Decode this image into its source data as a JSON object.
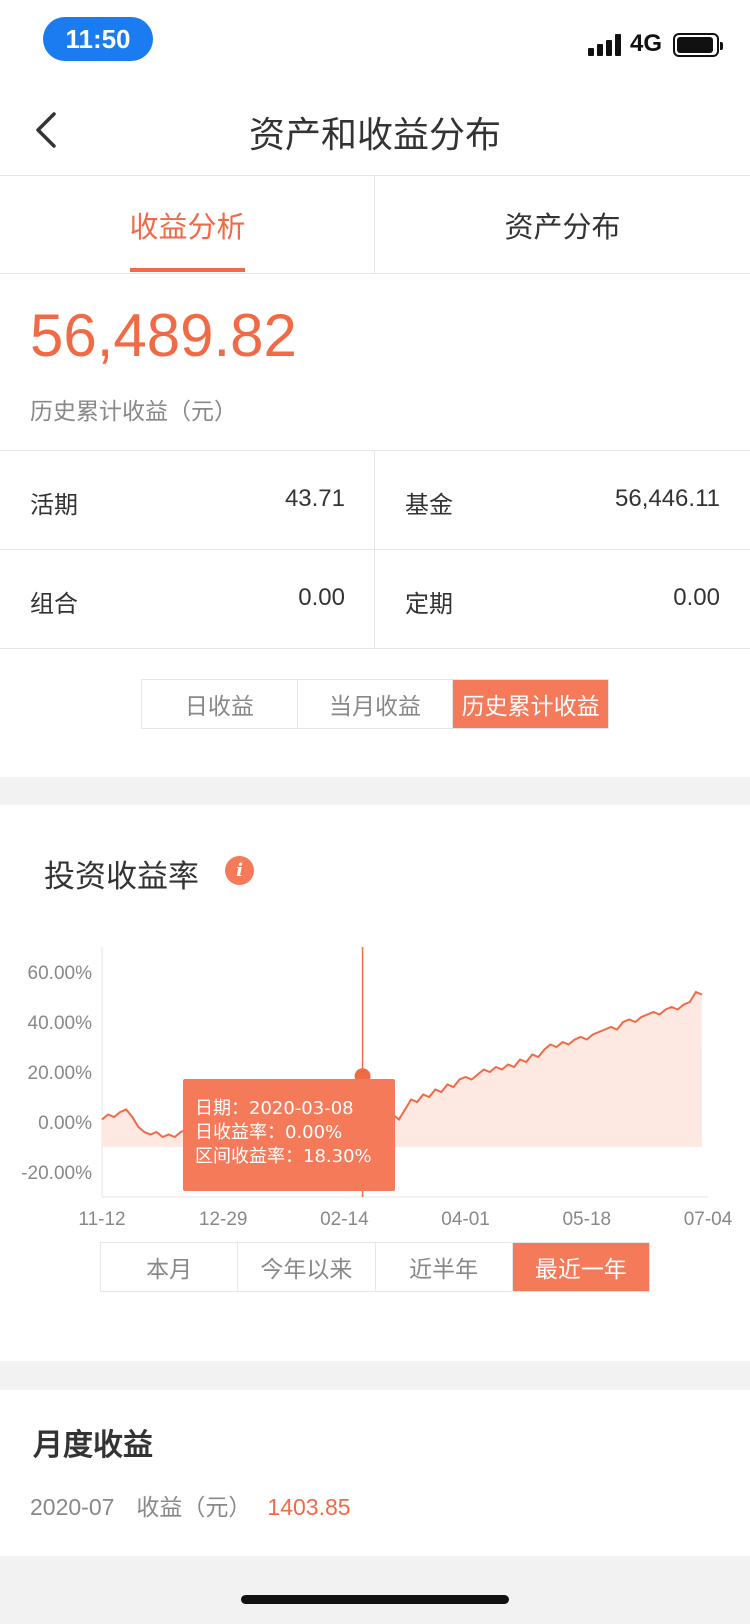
{
  "status_bar": {
    "time": "11:50",
    "network": "4G"
  },
  "nav": {
    "title": "资产和收益分布"
  },
  "tabs": [
    {
      "label": "收益分析",
      "active": true
    },
    {
      "label": "资产分布",
      "active": false
    }
  ],
  "summary": {
    "total": "56,489.82",
    "total_label": "历史累计收益（元）"
  },
  "breakdown": [
    {
      "label": "活期",
      "value": "43.71"
    },
    {
      "label": "基金",
      "value": "56,446.11"
    },
    {
      "label": "组合",
      "value": "0.00"
    },
    {
      "label": "定期",
      "value": "0.00"
    }
  ],
  "earnings_segments": [
    {
      "label": "日收益"
    },
    {
      "label": "当月收益"
    },
    {
      "label": "历史累计收益",
      "active": true
    }
  ],
  "return_section": {
    "title": "投资收益率",
    "info_icon": "info-icon"
  },
  "tooltip": {
    "date": "日期：2020-03-08",
    "daily": "日收益率：0.00%",
    "range": "区间收益率：18.30%"
  },
  "period_segments": [
    {
      "label": "本月"
    },
    {
      "label": "今年以来"
    },
    {
      "label": "近半年"
    },
    {
      "label": "最近一年",
      "active": true
    }
  ],
  "chart_data": {
    "type": "area",
    "title": "投资收益率",
    "x_tick_labels": [
      "11-12",
      "12-29",
      "02-14",
      "04-01",
      "05-18",
      "07-04"
    ],
    "y_tick_labels": [
      "60.00%",
      "40.00%",
      "20.00%",
      "0.00%",
      "-20.00%"
    ],
    "ylim": [
      -30,
      70
    ],
    "y_ticks": [
      60,
      40,
      20,
      0,
      -20
    ],
    "x_index_range": [
      0,
      100
    ],
    "series": [
      {
        "values": [
          [
            0,
            1
          ],
          [
            1,
            3
          ],
          [
            2,
            2
          ],
          [
            3,
            4
          ],
          [
            4,
            5
          ],
          [
            5,
            2
          ],
          [
            6,
            -2
          ],
          [
            7,
            -4
          ],
          [
            8,
            -5
          ],
          [
            9,
            -4
          ],
          [
            10,
            -6
          ],
          [
            11,
            -5
          ],
          [
            12,
            -6
          ],
          [
            13,
            -4
          ],
          [
            14,
            -3
          ],
          [
            15,
            -5
          ],
          [
            16,
            -4
          ],
          [
            17,
            -6
          ],
          [
            18,
            -3
          ],
          [
            19,
            -2
          ],
          [
            20,
            -4
          ],
          [
            21,
            -3
          ],
          [
            22,
            -2
          ],
          [
            23,
            -1
          ],
          [
            24,
            -3
          ],
          [
            25,
            -2
          ],
          [
            26,
            0
          ],
          [
            27,
            1
          ],
          [
            28,
            -1
          ],
          [
            29,
            0
          ],
          [
            30,
            2
          ],
          [
            31,
            1
          ],
          [
            32,
            0
          ],
          [
            33,
            2
          ],
          [
            34,
            3
          ],
          [
            35,
            1
          ],
          [
            36,
            2
          ],
          [
            37,
            4
          ],
          [
            38,
            3
          ],
          [
            39,
            5
          ],
          [
            40,
            8
          ],
          [
            41,
            12
          ],
          [
            42,
            16
          ],
          [
            43,
            18.3
          ],
          [
            44,
            14
          ],
          [
            45,
            6
          ],
          [
            46,
            2
          ],
          [
            47,
            0
          ],
          [
            48,
            3
          ],
          [
            49,
            1
          ],
          [
            50,
            5
          ],
          [
            51,
            9
          ],
          [
            52,
            8
          ],
          [
            53,
            11
          ],
          [
            54,
            10
          ],
          [
            55,
            13
          ],
          [
            56,
            12
          ],
          [
            57,
            15
          ],
          [
            58,
            14
          ],
          [
            59,
            17
          ],
          [
            60,
            18
          ],
          [
            61,
            17
          ],
          [
            62,
            19
          ],
          [
            63,
            21
          ],
          [
            64,
            20
          ],
          [
            65,
            22
          ],
          [
            66,
            21
          ],
          [
            67,
            23
          ],
          [
            68,
            22
          ],
          [
            69,
            25
          ],
          [
            70,
            24
          ],
          [
            71,
            27
          ],
          [
            72,
            26
          ],
          [
            73,
            29
          ],
          [
            74,
            31
          ],
          [
            75,
            30
          ],
          [
            76,
            32
          ],
          [
            77,
            31
          ],
          [
            78,
            33
          ],
          [
            79,
            34
          ],
          [
            80,
            33
          ],
          [
            81,
            35
          ],
          [
            82,
            36
          ],
          [
            83,
            37
          ],
          [
            84,
            38
          ],
          [
            85,
            37
          ],
          [
            86,
            40
          ],
          [
            87,
            41
          ],
          [
            88,
            40
          ],
          [
            89,
            42
          ],
          [
            90,
            43
          ],
          [
            91,
            44
          ],
          [
            92,
            43
          ],
          [
            93,
            45
          ],
          [
            94,
            46
          ],
          [
            95,
            45
          ],
          [
            96,
            47
          ],
          [
            97,
            48
          ],
          [
            98,
            52
          ],
          [
            99,
            51
          ]
        ]
      }
    ],
    "highlight": {
      "x_index": 43,
      "y": 18.3,
      "label": "2020-03-08"
    },
    "colors": {
      "line": "#f06a46",
      "fill": "#fde9e1",
      "guide": "#f06a46"
    }
  },
  "monthly": {
    "title": "月度收益",
    "month": "2020-07",
    "label": "收益（元）",
    "amount": "1403.85"
  },
  "colors": {
    "accent": "#f06a46",
    "accent_bg": "#f47a5a"
  }
}
